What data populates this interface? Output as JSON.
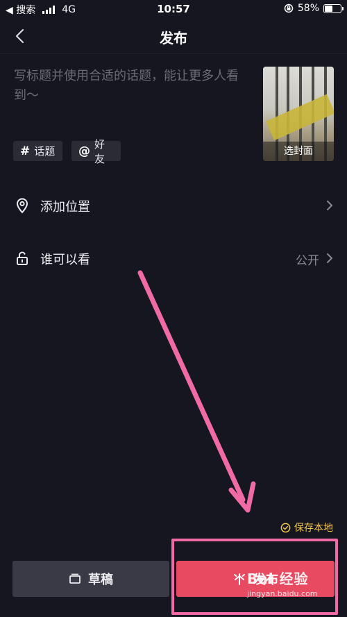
{
  "status_bar": {
    "back_app": "◀ 搜索",
    "network": "4G",
    "time": "10:57",
    "battery": "58%",
    "battery_level": 0.58
  },
  "nav": {
    "title": "发布"
  },
  "compose": {
    "placeholder": "写标题并使用合适的话题，能让更多人看到～",
    "cover_label": "选封面",
    "hashtag_chip": {
      "symbol": "#",
      "label": "话题"
    },
    "mention_chip": {
      "symbol": "@",
      "label": "好友"
    }
  },
  "options": {
    "location": {
      "label": "添加位置"
    },
    "visibility": {
      "label": "谁可以看",
      "value": "公开"
    }
  },
  "save_local": "保存本地",
  "actions": {
    "draft": "草稿",
    "publish": "发布"
  },
  "watermark": {
    "main": "Bai 经验",
    "sub": "jingyan.baidu.com"
  },
  "colors": {
    "background": "#161621",
    "publish_button": "#e84a62",
    "draft_button": "#3a3a46",
    "accent_yellow": "#f4c84a",
    "annotation_pink": "#f06aa6"
  }
}
